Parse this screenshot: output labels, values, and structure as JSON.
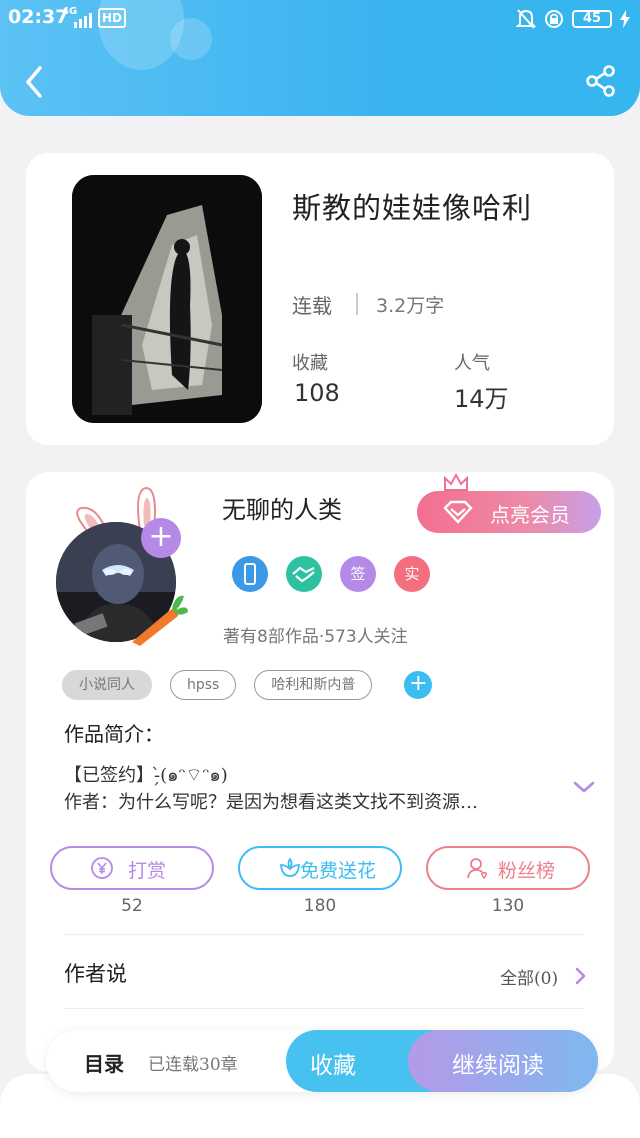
{
  "status_bar": {
    "time": "02:37",
    "network": "4G",
    "hd": "HD",
    "battery": "45"
  },
  "book": {
    "title": "斯教的娃娃像哈利",
    "status": "连载",
    "words": "3.2万字",
    "favorites_label": "收藏",
    "favorites_value": "108",
    "popularity_label": "人气",
    "popularity_value": "14万"
  },
  "author": {
    "name": "无聊的人类",
    "vip_button": "点亮会员",
    "badges": [
      {
        "icon": "phone-badge-icon",
        "color": "#3a9ae8"
      },
      {
        "icon": "handshake-badge-icon",
        "color": "#2dc1a2"
      },
      {
        "text": "签",
        "color": "#b48ae6"
      },
      {
        "text": "实",
        "color": "#f36f7f"
      }
    ],
    "meta": "著有8部作品·573人关注"
  },
  "tags": [
    "小说同人",
    "hpss",
    "哈利和斯内普"
  ],
  "intro": {
    "title": "作品简介：",
    "line1": "【已签约】-̗̀(๑ᵔ⌔ᵔ๑)",
    "line2": "作者：为什么写呢？是因为想看这类文找不到资源…"
  },
  "actions": [
    {
      "label": "打赏",
      "count": "52",
      "color": "#b48ae6",
      "icon": "yen-icon"
    },
    {
      "label": "免费送花",
      "count": "180",
      "color": "#3cbdf2",
      "icon": "flower-icon"
    },
    {
      "label": "粉丝榜",
      "count": "130",
      "color": "#ef7d8c",
      "icon": "fans-icon"
    }
  ],
  "author_say": {
    "title": "作者说",
    "all": "全部(0)"
  },
  "bottom_bar": {
    "toc": "目录",
    "toc_sub": "已连载30章",
    "favorite": "收藏",
    "continue": "继续阅读"
  }
}
